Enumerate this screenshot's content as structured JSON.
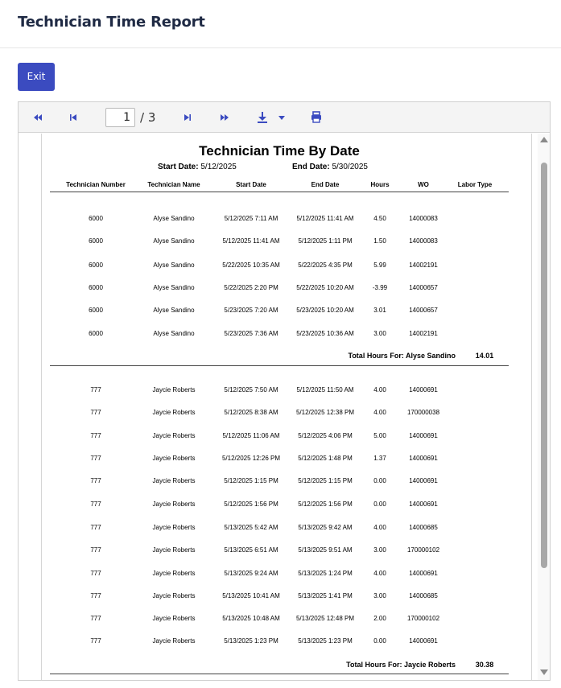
{
  "header": {
    "title": "Technician Time Report"
  },
  "actions": {
    "exit_label": "Exit"
  },
  "toolbar": {
    "current_page": "1",
    "total_pages": "/ 3"
  },
  "report": {
    "title": "Technician Time By Date",
    "start_date_label": "Start Date:",
    "start_date": "5/12/2025",
    "end_date_label": "End Date:",
    "end_date": "5/30/2025",
    "columns": [
      "Technician Number",
      "Technician Name",
      "Start Date",
      "End Date",
      "Hours",
      "WO",
      "Labor Type"
    ],
    "groups": [
      {
        "total_label": "Total Hours For: Alyse Sandino",
        "total_value": "14.01",
        "rows": [
          [
            "6000",
            "Alyse Sandino",
            "5/12/2025 7:11 AM",
            "5/12/2025 11:41 AM",
            "4.50",
            "14000083",
            ""
          ],
          [
            "6000",
            "Alyse Sandino",
            "5/12/2025 11:41 AM",
            "5/12/2025 1:11 PM",
            "1.50",
            "14000083",
            ""
          ],
          [
            "6000",
            "Alyse Sandino",
            "5/22/2025 10:35 AM",
            "5/22/2025 4:35 PM",
            "5.99",
            "14002191",
            ""
          ],
          [
            "6000",
            "Alyse Sandino",
            "5/22/2025 2:20 PM",
            "5/22/2025 10:20 AM",
            "-3.99",
            "14000657",
            ""
          ],
          [
            "6000",
            "Alyse Sandino",
            "5/23/2025 7:20 AM",
            "5/23/2025 10:20 AM",
            "3.01",
            "14000657",
            ""
          ],
          [
            "6000",
            "Alyse Sandino",
            "5/23/2025 7:36 AM",
            "5/23/2025 10:36 AM",
            "3.00",
            "14002191",
            ""
          ]
        ]
      },
      {
        "total_label": "Total Hours For: Jaycie Roberts",
        "total_value": "30.38",
        "rows": [
          [
            "777",
            "Jaycie Roberts",
            "5/12/2025 7:50 AM",
            "5/12/2025 11:50 AM",
            "4.00",
            "14000691",
            ""
          ],
          [
            "777",
            "Jaycie Roberts",
            "5/12/2025 8:38 AM",
            "5/12/2025 12:38 PM",
            "4.00",
            "170000038",
            ""
          ],
          [
            "777",
            "Jaycie Roberts",
            "5/12/2025 11:06 AM",
            "5/12/2025 4:06 PM",
            "5.00",
            "14000691",
            ""
          ],
          [
            "777",
            "Jaycie Roberts",
            "5/12/2025 12:26 PM",
            "5/12/2025 1:48 PM",
            "1.37",
            "14000691",
            ""
          ],
          [
            "777",
            "Jaycie Roberts",
            "5/12/2025 1:15 PM",
            "5/12/2025 1:15 PM",
            "0.00",
            "14000691",
            ""
          ],
          [
            "777",
            "Jaycie Roberts",
            "5/12/2025 1:56 PM",
            "5/12/2025 1:56 PM",
            "0.00",
            "14000691",
            ""
          ],
          [
            "777",
            "Jaycie Roberts",
            "5/13/2025 5:42 AM",
            "5/13/2025 9:42 AM",
            "4.00",
            "14000685",
            ""
          ],
          [
            "777",
            "Jaycie Roberts",
            "5/13/2025 6:51 AM",
            "5/13/2025 9:51 AM",
            "3.00",
            "170000102",
            ""
          ],
          [
            "777",
            "Jaycie Roberts",
            "5/13/2025 9:24 AM",
            "5/13/2025 1:24 PM",
            "4.00",
            "14000691",
            ""
          ],
          [
            "777",
            "Jaycie Roberts",
            "5/13/2025 10:41 AM",
            "5/13/2025 1:41 PM",
            "3.00",
            "14000685",
            ""
          ],
          [
            "777",
            "Jaycie Roberts",
            "5/13/2025 10:48 AM",
            "5/13/2025 12:48 PM",
            "2.00",
            "170000102",
            ""
          ],
          [
            "777",
            "Jaycie Roberts",
            "5/13/2025 1:23 PM",
            "5/13/2025 1:23 PM",
            "0.00",
            "14000691",
            ""
          ]
        ]
      }
    ]
  }
}
